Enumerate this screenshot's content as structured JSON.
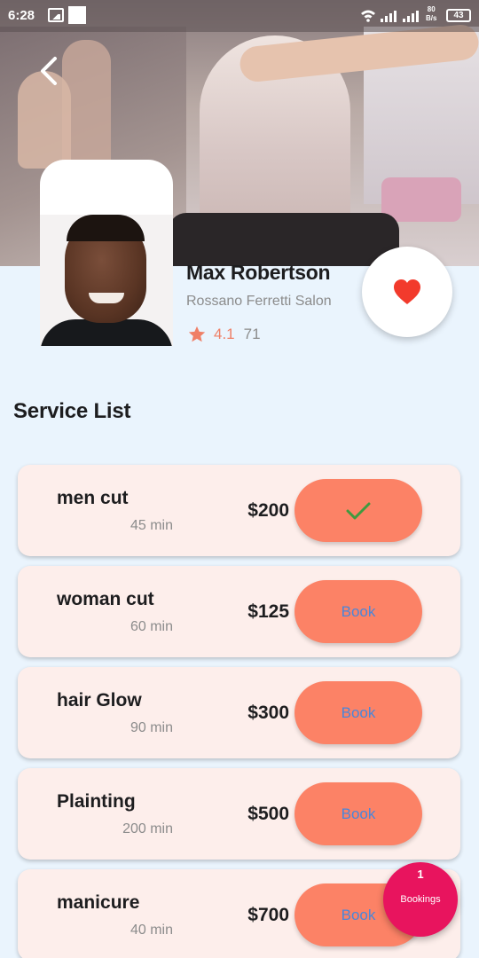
{
  "status_bar": {
    "time": "6:28",
    "speed_value": "80",
    "speed_unit": "B/s",
    "battery": "43"
  },
  "profile": {
    "name": "Max Robertson",
    "salon": "Rossano Ferretti Salon",
    "rating": "4.1",
    "reviews": "71",
    "favorited": true
  },
  "section_title": "Service List",
  "services": [
    {
      "name": "men cut",
      "duration": "45 min",
      "price": "$200",
      "action": "",
      "booked": true
    },
    {
      "name": "woman cut",
      "duration": "60 min",
      "price": "$125",
      "action": "Book",
      "booked": false
    },
    {
      "name": "hair Glow",
      "duration": "90 min",
      "price": "$300",
      "action": "Book",
      "booked": false
    },
    {
      "name": "Plainting",
      "duration": "200 min",
      "price": "$500",
      "action": "Book",
      "booked": false
    },
    {
      "name": "manicure",
      "duration": "40 min",
      "price": "$700",
      "action": "Book",
      "booked": false
    }
  ],
  "bookings": {
    "count": "1",
    "label": "Bookings"
  },
  "colors": {
    "background": "#eaf4fd",
    "card": "#fdeeeb",
    "button": "#fc8266",
    "button_text": "#4a86d9",
    "heart": "#f23a2c",
    "star": "#ef7f66",
    "check": "#3f9a3f",
    "fab": "#e8145e"
  },
  "icons": {
    "back": "chevron-left-icon",
    "favorite": "heart-icon",
    "rating": "star-icon",
    "booked": "check-icon"
  }
}
